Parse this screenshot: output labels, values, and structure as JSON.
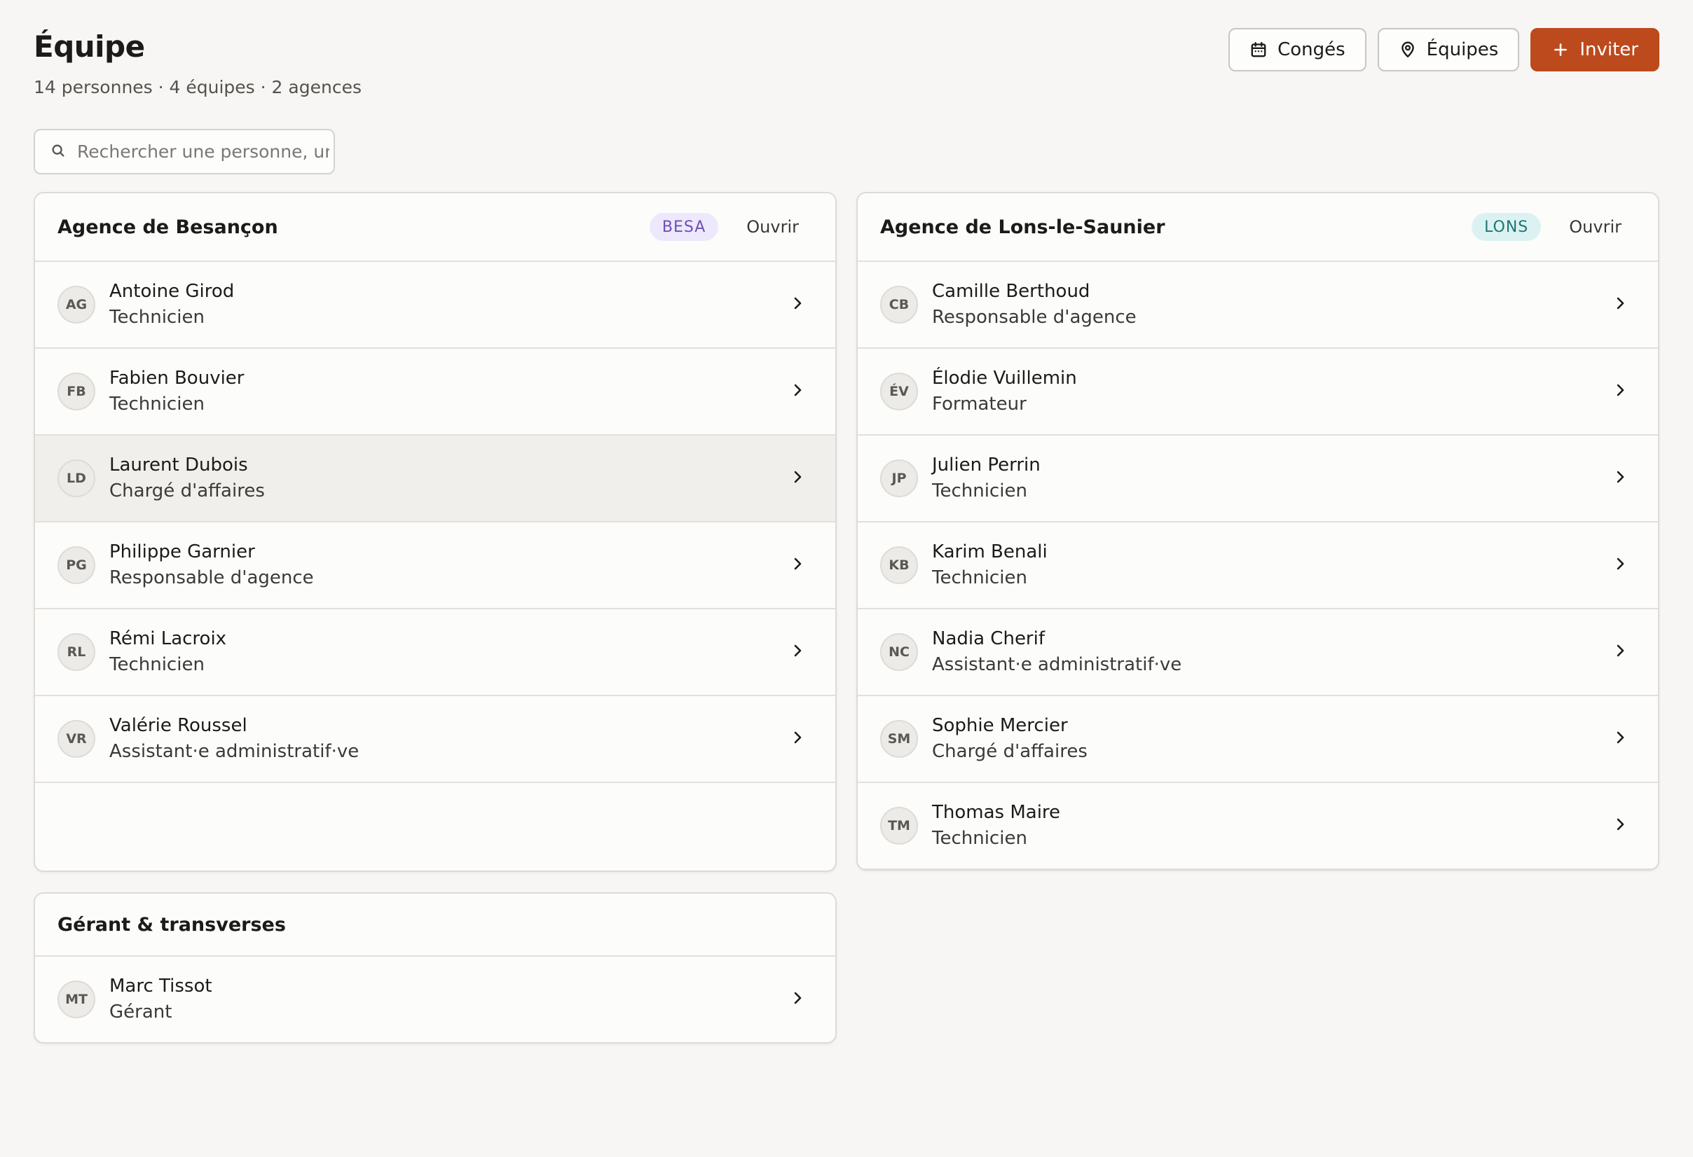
{
  "header": {
    "title": "Équipe",
    "subtitle": "14 personnes · 4 équipes · 2 agences",
    "buttons": {
      "leave": "Congés",
      "teams": "Équipes",
      "invite": "Inviter"
    }
  },
  "search": {
    "placeholder": "Rechercher une personne, un"
  },
  "icons": {
    "leave": "calendar-icon",
    "teams": "map-pin-icon",
    "invite": "plus-icon",
    "search": "search-icon",
    "row": "chevron-right-icon"
  },
  "colors": {
    "accent": "#bc4a1c",
    "badge_besa": "#6b4fb8",
    "badge_lons": "#1d7773"
  },
  "agencies": [
    {
      "name": "Agence de Besançon",
      "code": "BESA",
      "open_label": "Ouvrir",
      "members": [
        {
          "initials": "AG",
          "name": "Antoine Girod",
          "role": "Technicien"
        },
        {
          "initials": "FB",
          "name": "Fabien Bouvier",
          "role": "Technicien"
        },
        {
          "initials": "LD",
          "name": "Laurent Dubois",
          "role": "Chargé d'affaires"
        },
        {
          "initials": "PG",
          "name": "Philippe Garnier",
          "role": "Responsable d'agence"
        },
        {
          "initials": "RL",
          "name": "Rémi Lacroix",
          "role": "Technicien"
        },
        {
          "initials": "VR",
          "name": "Valérie Roussel",
          "role": "Assistant·e administratif·ve"
        }
      ]
    },
    {
      "name": "Agence de Lons-le-Saunier",
      "code": "LONS",
      "open_label": "Ouvrir",
      "members": [
        {
          "initials": "CB",
          "name": "Camille Berthoud",
          "role": "Responsable d'agence"
        },
        {
          "initials": "ÉV",
          "name": "Élodie Vuillemin",
          "role": "Formateur"
        },
        {
          "initials": "JP",
          "name": "Julien Perrin",
          "role": "Technicien"
        },
        {
          "initials": "KB",
          "name": "Karim Benali",
          "role": "Technicien"
        },
        {
          "initials": "NC",
          "name": "Nadia Cherif",
          "role": "Assistant·e administratif·ve"
        },
        {
          "initials": "SM",
          "name": "Sophie Mercier",
          "role": "Chargé d'affaires"
        },
        {
          "initials": "TM",
          "name": "Thomas Maire",
          "role": "Technicien"
        }
      ]
    }
  ],
  "transverse": {
    "name": "Gérant & transverses",
    "members": [
      {
        "initials": "MT",
        "name": "Marc Tissot",
        "role": "Gérant"
      }
    ]
  }
}
